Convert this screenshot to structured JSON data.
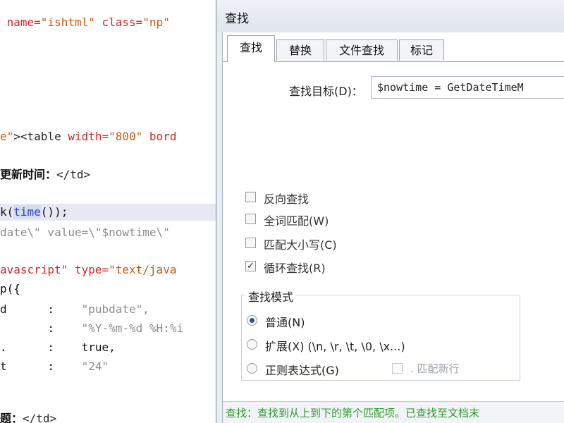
{
  "editor": {
    "lines": [
      {
        "parts": [
          {
            "t": " name=",
            "c": "c-attr"
          },
          {
            "t": "\"ishtml\"",
            "c": "c-str"
          },
          {
            "t": " class=",
            "c": "c-attr"
          },
          {
            "t": "\"np\"",
            "c": "c-str"
          }
        ]
      },
      {
        "parts": [
          {
            "t": "e\"",
            "c": "c-str"
          },
          {
            "t": "><table ",
            "c": "c-tag"
          },
          {
            "t": "width=",
            "c": "c-attr"
          },
          {
            "t": "\"800\"",
            "c": "c-str"
          },
          {
            "t": " bord",
            "c": "c-attr"
          }
        ]
      },
      {
        "parts": [
          {
            "t": "更新时间：",
            "c": "c-bold"
          },
          {
            "t": "</td>",
            "c": "c-tag"
          }
        ]
      },
      {
        "parts": [
          {
            "t": "k(",
            "c": "c-black"
          },
          {
            "t": "time",
            "c": "c-fn"
          },
          {
            "t": "());",
            "c": "c-black"
          }
        ]
      },
      {
        "parts": [
          {
            "t": "date\\\" value=\\\"$nowtime\\\"",
            "c": "c-gray"
          }
        ]
      },
      {
        "parts": [
          {
            "t": "avascript\"",
            "c": "c-attr"
          },
          {
            "t": " type=",
            "c": "c-attr"
          },
          {
            "t": "\"text/java",
            "c": "c-str"
          }
        ]
      },
      {
        "parts": [
          {
            "t": "p({",
            "c": "c-black"
          }
        ]
      },
      {
        "parts": [
          {
            "t": "d      :    ",
            "c": "c-black"
          },
          {
            "t": "\"pubdate\",",
            "c": "c-gray"
          }
        ]
      },
      {
        "parts": [
          {
            "t": "       :    ",
            "c": "c-black"
          },
          {
            "t": "\"%Y-%m-%d %H:%i",
            "c": "c-gray"
          }
        ]
      },
      {
        "parts": [
          {
            "t": ".      :    ",
            "c": "c-black"
          },
          {
            "t": "true,",
            "c": "c-black"
          }
        ]
      },
      {
        "parts": [
          {
            "t": "t      :    ",
            "c": "c-black"
          },
          {
            "t": "\"24\"",
            "c": "c-gray"
          }
        ]
      },
      {
        "parts": [
          {
            "t": "题：",
            "c": "c-bold"
          },
          {
            "t": "</td>",
            "c": "c-tag"
          }
        ]
      }
    ]
  },
  "dialog": {
    "title": "查找",
    "tabs": [
      {
        "label": "查找",
        "active": true
      },
      {
        "label": "替换",
        "active": false
      },
      {
        "label": "文件查找",
        "active": false
      },
      {
        "label": "标记",
        "active": false
      }
    ],
    "target_label": "查找目标(D)：",
    "target_value": "$nowtime = GetDateTimeM",
    "options": [
      {
        "label": "反向查找",
        "checked": false
      },
      {
        "label": "全词匹配(W)",
        "checked": false
      },
      {
        "label": "匹配大小写(C)",
        "checked": false
      },
      {
        "label": "循环查找(R)",
        "checked": true
      }
    ],
    "search_mode": {
      "legend": "查找模式",
      "modes": [
        {
          "label": "普通(N)",
          "selected": true
        },
        {
          "label": "扩展(X) (\\n, \\r, \\t, \\0, \\x...)",
          "selected": false
        },
        {
          "label": "正则表达式(G)",
          "selected": false
        }
      ],
      "match_newline_label": ". 匹配新行"
    },
    "status": "查找：查找到从上到下的第个匹配项。已查找至文档末"
  },
  "colors": {
    "status_text": "#2f9a2f",
    "editor_highlight": "#e6e9f1",
    "dialog_bg": "#eaeef5"
  }
}
